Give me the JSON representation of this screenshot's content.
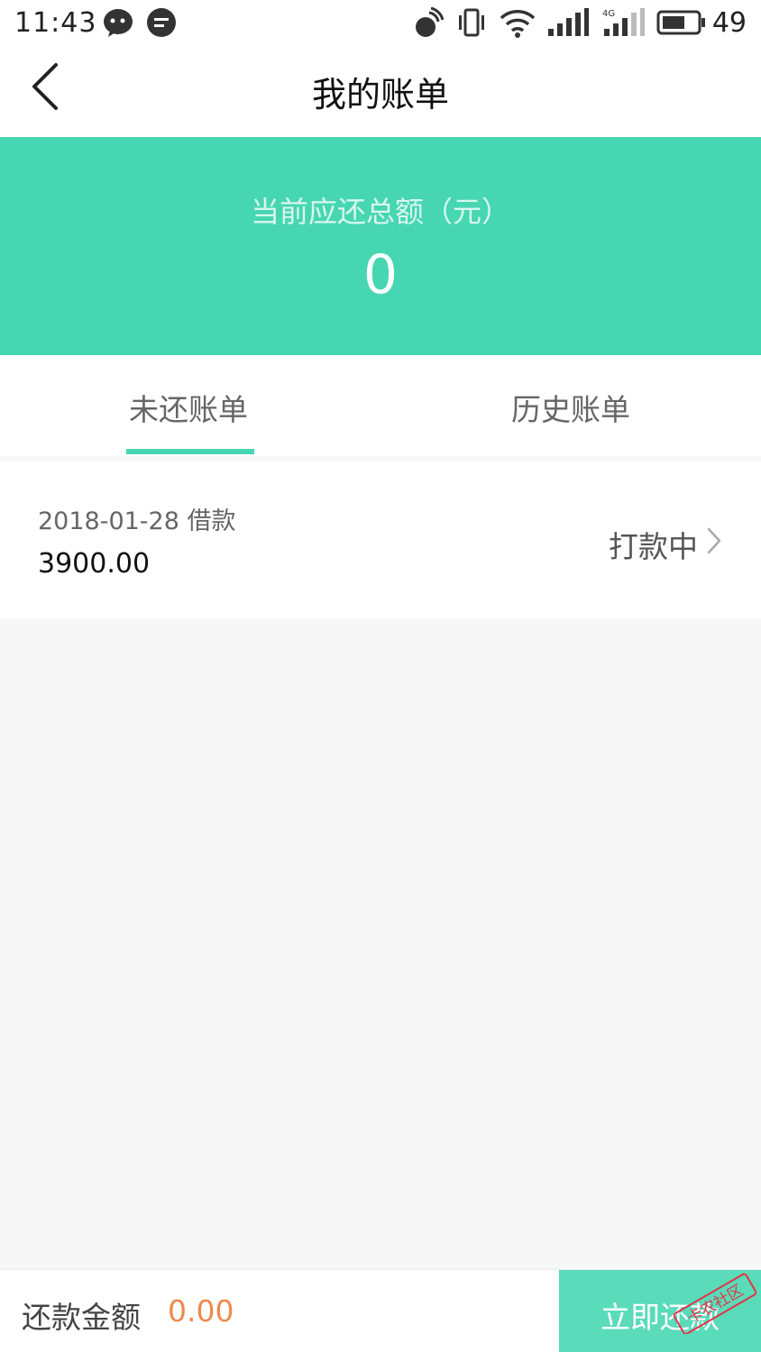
{
  "status_bar": {
    "time": "11:43",
    "battery_level": "49",
    "icons": [
      "chat-bubble-icon",
      "message-icon",
      "satellite-icon",
      "vibrate-icon",
      "wifi-icon",
      "signal-icon",
      "signal-4g-icon",
      "battery-icon"
    ]
  },
  "header": {
    "title": "我的账单",
    "back_icon": "chevron-left-icon"
  },
  "banner": {
    "label": "当前应还总额（元）",
    "amount": "0",
    "background": "#47d6b2"
  },
  "tabs": {
    "items": [
      {
        "label": "未还账单",
        "active": true
      },
      {
        "label": "历史账单",
        "active": false
      }
    ],
    "accent": "#47d6b2"
  },
  "bills": [
    {
      "date_type": "2018-01-28  借款",
      "amount": "3900.00",
      "status": "打款中"
    }
  ],
  "bottom_bar": {
    "label": "还款金额",
    "amount": "0.00",
    "amount_color": "#ee8a4e",
    "button_label": "立即还款",
    "watermark_text": "卡农社区"
  }
}
